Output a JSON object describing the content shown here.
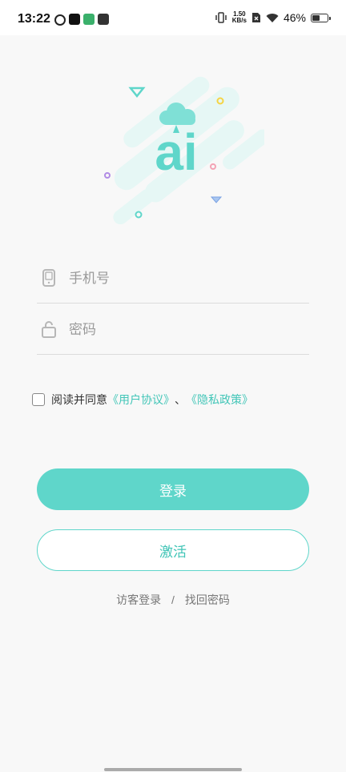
{
  "status_bar": {
    "time": "13:22",
    "speed_value": "1.50",
    "speed_unit": "KB/s",
    "battery": "46%",
    "battery_level": 0.46
  },
  "logo": {
    "text": "ai"
  },
  "form": {
    "phone_placeholder": "手机号",
    "password_placeholder": "密码"
  },
  "agreement": {
    "prefix": "阅读并同意",
    "user_agreement": "《用户协议》",
    "separator": "、",
    "privacy_policy": "《隐私政策》"
  },
  "buttons": {
    "login": "登录",
    "activate": "激活"
  },
  "links": {
    "guest_login": "访客登录",
    "divider": "/",
    "recover_password": "找回密码"
  },
  "colors": {
    "accent": "#5fd6ca",
    "accent_text": "#43c6b8",
    "background": "#f8f8f8"
  }
}
